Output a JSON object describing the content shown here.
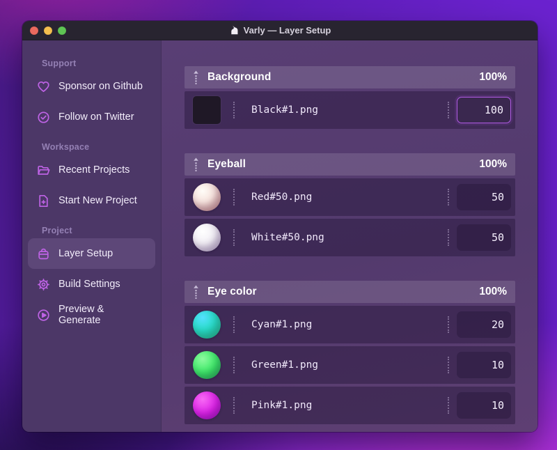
{
  "window": {
    "title": "Varly — Layer Setup",
    "app_icon": "unicorn-icon"
  },
  "titlebar": {
    "buttons": [
      {
        "name": "close",
        "color": "#ec6a5f"
      },
      {
        "name": "minimize",
        "color": "#f4bf4f"
      },
      {
        "name": "zoom",
        "color": "#5fc454"
      }
    ]
  },
  "sidebar": {
    "sections": [
      {
        "label": "Support",
        "items": [
          {
            "label": "Sponsor on Github",
            "icon": "heart-icon",
            "active": false
          },
          {
            "label": "Follow on Twitter",
            "icon": "verified-badge-icon",
            "active": false
          }
        ]
      },
      {
        "label": "Workspace",
        "items": [
          {
            "label": "Recent Projects",
            "icon": "folder-open-icon",
            "active": false
          },
          {
            "label": "Start New Project",
            "icon": "file-plus-icon",
            "active": false
          }
        ]
      },
      {
        "label": "Project",
        "items": [
          {
            "label": "Layer Setup",
            "icon": "archive-box-icon",
            "active": true
          },
          {
            "label": "Build Settings",
            "icon": "gear-icon",
            "active": false
          },
          {
            "label": "Preview & Generate",
            "icon": "play-circle-icon",
            "active": false
          }
        ]
      }
    ]
  },
  "layers": {
    "groups": [
      {
        "name": "Background",
        "weight": "100%",
        "items": [
          {
            "file": "Black#1.png",
            "value": "100",
            "thumb": "black-square",
            "focused": true
          }
        ]
      },
      {
        "name": "Eyeball",
        "weight": "100%",
        "items": [
          {
            "file": "Red#50.png",
            "value": "50",
            "thumb": "red-sphere",
            "focused": false
          },
          {
            "file": "White#50.png",
            "value": "50",
            "thumb": "white-sphere",
            "focused": false
          }
        ]
      },
      {
        "name": "Eye color",
        "weight": "100%",
        "items": [
          {
            "file": "Cyan#1.png",
            "value": "20",
            "thumb": "cyan-sphere",
            "focused": false
          },
          {
            "file": "Green#1.png",
            "value": "10",
            "thumb": "green-sphere",
            "focused": false
          },
          {
            "file": "Pink#1.png",
            "value": "10",
            "thumb": "pink-sphere",
            "focused": false
          }
        ]
      }
    ]
  },
  "colors": {
    "accent": "#bf63e6",
    "focus_border": "#b25be6",
    "traffic_red": "#ec6a5f",
    "traffic_yellow": "#f4bf4f",
    "traffic_green": "#5fc454",
    "sidebar_bg": "#4c3767",
    "titlebar_bg": "#282430",
    "thumb_black": "#1f1826",
    "thumb_cyan": "#23dbc0",
    "thumb_green": "#35ea62",
    "thumb_pink": "#dc1fe7"
  }
}
